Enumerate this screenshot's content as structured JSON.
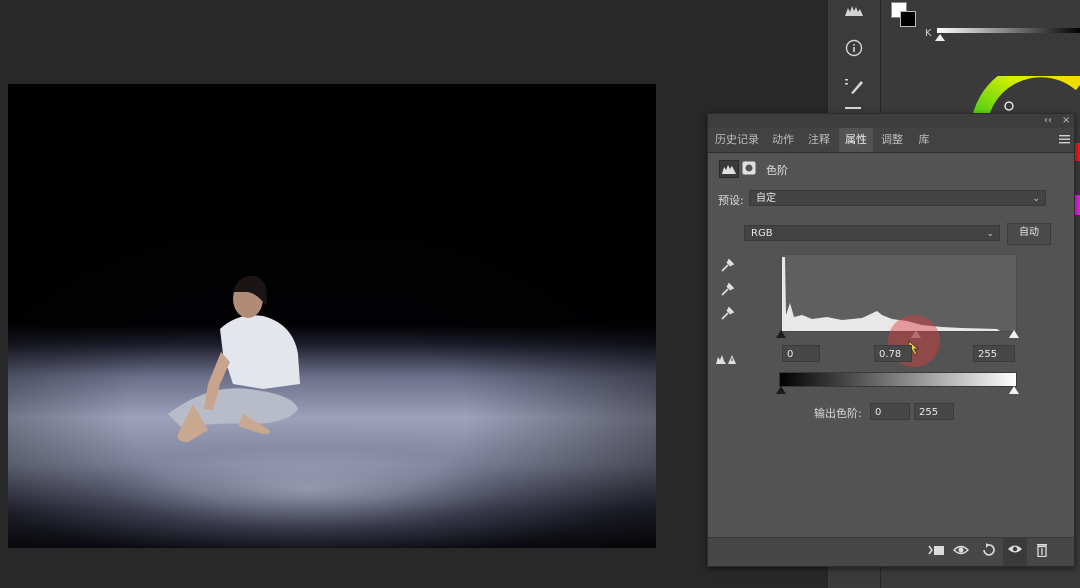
{
  "panel": {
    "tabs": [
      "历史记录",
      "动作",
      "注释",
      "属性",
      "调整",
      "库"
    ],
    "active_tab": "属性",
    "title": "色阶",
    "preset_label": "预设:",
    "preset_value": "自定",
    "channel_value": "RGB",
    "auto_label": "自动",
    "input_black": "0",
    "input_gamma": "0.78",
    "input_white": "255",
    "output_label": "输出色阶:",
    "output_black": "0",
    "output_white": "255",
    "collapse_glyph": "‹‹",
    "close_glyph": "×"
  },
  "color_panel": {
    "channel_letter": "K"
  },
  "icons": [
    "levels-icon",
    "mask-icon",
    "eyedropper-black-icon",
    "eyedropper-gray-icon",
    "eyedropper-white-icon",
    "clip-warning-icon",
    "clip-to-layer-icon",
    "view-previous-icon",
    "reset-icon",
    "visibility-icon",
    "trash-icon",
    "histogram-icon",
    "info-icon",
    "brush-presets-icon"
  ],
  "colors": {
    "panel_bg": "#535353",
    "tab_bar": "#424242",
    "app_bg": "#282828"
  }
}
